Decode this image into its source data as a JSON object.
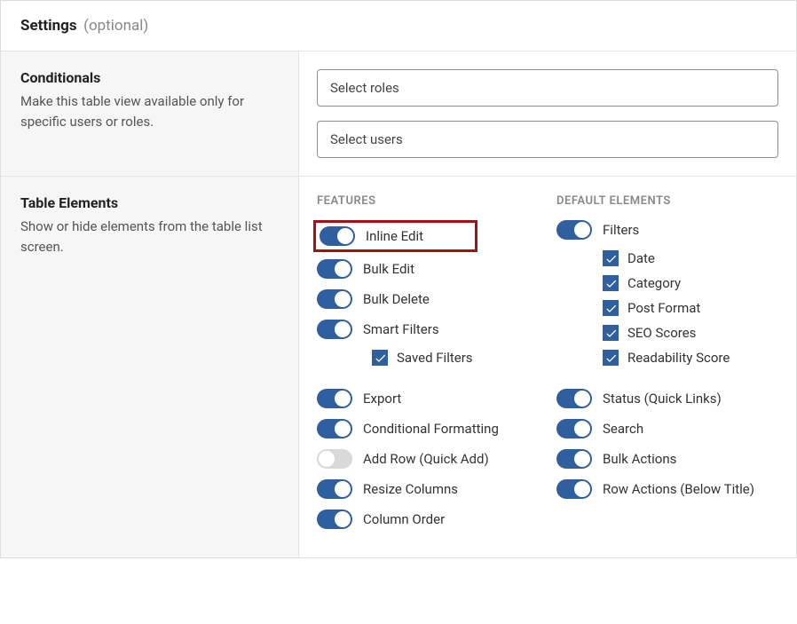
{
  "header": {
    "title": "Settings",
    "subtitle": "(optional)"
  },
  "conditionals": {
    "title": "Conditionals",
    "desc": "Make this table view available only for specific users or roles.",
    "select_roles": "Select roles",
    "select_users": "Select users"
  },
  "table_elements": {
    "title": "Table Elements",
    "desc": "Show or hide elements from the table list screen.",
    "features_header": "FEATURES",
    "default_header": "DEFAULT ELEMENTS",
    "features": {
      "inline_edit": {
        "label": "Inline Edit",
        "on": true
      },
      "bulk_edit": {
        "label": "Bulk Edit",
        "on": true
      },
      "bulk_delete": {
        "label": "Bulk Delete",
        "on": true
      },
      "smart_filters": {
        "label": "Smart Filters",
        "on": true
      },
      "saved_filters": {
        "label": "Saved Filters",
        "checked": true
      },
      "export": {
        "label": "Export",
        "on": true
      },
      "conditional_formatting": {
        "label": "Conditional Formatting",
        "on": true
      },
      "add_row": {
        "label": "Add Row (Quick Add)",
        "on": false
      },
      "resize_columns": {
        "label": "Resize Columns",
        "on": true
      },
      "column_order": {
        "label": "Column Order",
        "on": true
      }
    },
    "default": {
      "filters": {
        "label": "Filters",
        "on": true
      },
      "date": {
        "label": "Date",
        "checked": true
      },
      "category": {
        "label": "Category",
        "checked": true
      },
      "post_format": {
        "label": "Post Format",
        "checked": true
      },
      "seo_scores": {
        "label": "SEO Scores",
        "checked": true
      },
      "readability_score": {
        "label": "Readability Score",
        "checked": true
      },
      "status": {
        "label": "Status (Quick Links)",
        "on": true
      },
      "search": {
        "label": "Search",
        "on": true
      },
      "bulk_actions": {
        "label": "Bulk Actions",
        "on": true
      },
      "row_actions": {
        "label": "Row Actions (Below Title)",
        "on": true
      }
    }
  }
}
